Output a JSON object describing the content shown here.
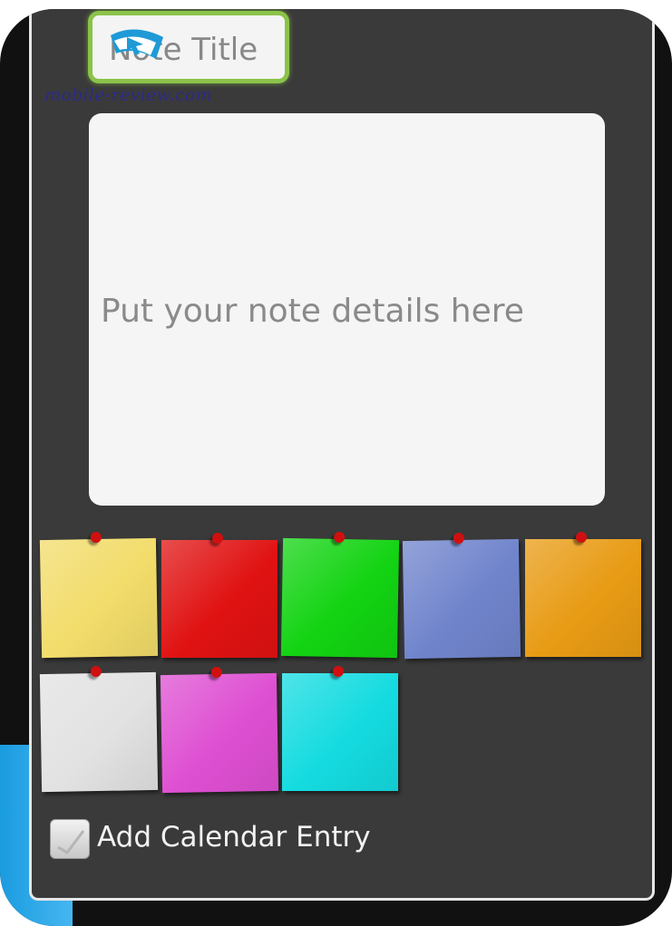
{
  "note_title": {
    "placeholder": "Note Title"
  },
  "watermark": "mobile-review.com",
  "note_details": {
    "placeholder": "Put your note details here"
  },
  "colors": [
    {
      "name": "yellow",
      "hex": "#f2dc6a"
    },
    {
      "name": "red",
      "hex": "#e01212"
    },
    {
      "name": "green",
      "hex": "#12d312"
    },
    {
      "name": "blue",
      "hex": "#7084cc"
    },
    {
      "name": "orange",
      "hex": "#e89b14"
    },
    {
      "name": "white",
      "hex": "#e2e2e2"
    },
    {
      "name": "magenta",
      "hex": "#de4fd2"
    },
    {
      "name": "cyan",
      "hex": "#14dbe0"
    }
  ],
  "calendar": {
    "label": "Add Calendar Entry"
  },
  "accent": "#8bc34a"
}
